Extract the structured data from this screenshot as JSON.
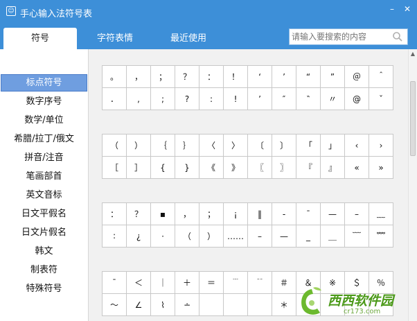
{
  "window": {
    "title": "手心输入法符号表",
    "icon": "smiley-icon",
    "minimize_label": "–",
    "close_label": "✕"
  },
  "tabs": [
    {
      "label": "符号",
      "active": true
    },
    {
      "label": "字符表情",
      "active": false
    },
    {
      "label": "最近使用",
      "active": false
    }
  ],
  "search": {
    "placeholder": "请输入要搜索的内容",
    "value": "",
    "icon": "search-icon"
  },
  "sidebar": {
    "items": [
      {
        "label": "标点符号",
        "active": true
      },
      {
        "label": "数字序号",
        "active": false
      },
      {
        "label": "数学/单位",
        "active": false
      },
      {
        "label": "希腊/拉丁/俄文",
        "active": false
      },
      {
        "label": "拼音/注音",
        "active": false
      },
      {
        "label": "笔画部首",
        "active": false
      },
      {
        "label": "英文音标",
        "active": false
      },
      {
        "label": "日文平假名",
        "active": false
      },
      {
        "label": "日文片假名",
        "active": false
      },
      {
        "label": "韩文",
        "active": false
      },
      {
        "label": "制表符",
        "active": false
      },
      {
        "label": "特殊符号",
        "active": false
      }
    ]
  },
  "symbol_groups": [
    {
      "rows": [
        [
          "。",
          "，",
          "；",
          "？",
          "：",
          "！",
          "‘",
          "’",
          "“",
          "”",
          "＠",
          "＾"
        ],
        [
          "．",
          ",",
          ";",
          "?",
          ":",
          "!",
          "’",
          "″",
          "‶",
          "〃",
          "@",
          "ˇ"
        ]
      ]
    },
    {
      "rows": [
        [
          "（",
          "）",
          "｛",
          "｝",
          "〈",
          "〉",
          "〔",
          "〕",
          "「",
          "」",
          "‹",
          "›"
        ],
        [
          "［",
          "］",
          "{",
          "}",
          "《",
          "》",
          "〖",
          "〗",
          "『",
          "』",
          "«",
          "»"
        ]
      ]
    },
    {
      "rows": [
        [
          "：",
          "？",
          "▪",
          "，",
          "；",
          "¡",
          "‖",
          "-",
          "¯",
          "—",
          "–",
          "﹏"
        ],
        [
          "∶",
          "¿",
          "·",
          "（",
          "）",
          "……",
          "–",
          "—",
          "_",
          "＿",
          "﹋",
          "﹌"
        ]
      ]
    },
    {
      "rows": [
        [
          "ˉ",
          "＜",
          "｜",
          "＋",
          "＝",
          "﹉",
          "﹊",
          "＃",
          "＆",
          "※",
          "＄",
          "％"
        ],
        [
          "～",
          "∠",
          "⌇",
          "∸",
          "",
          "",
          "",
          "＊",
          "",
          "",
          "",
          ""
        ]
      ]
    }
  ],
  "watermark": {
    "text": "西西软件园",
    "url": "cr173.com"
  }
}
